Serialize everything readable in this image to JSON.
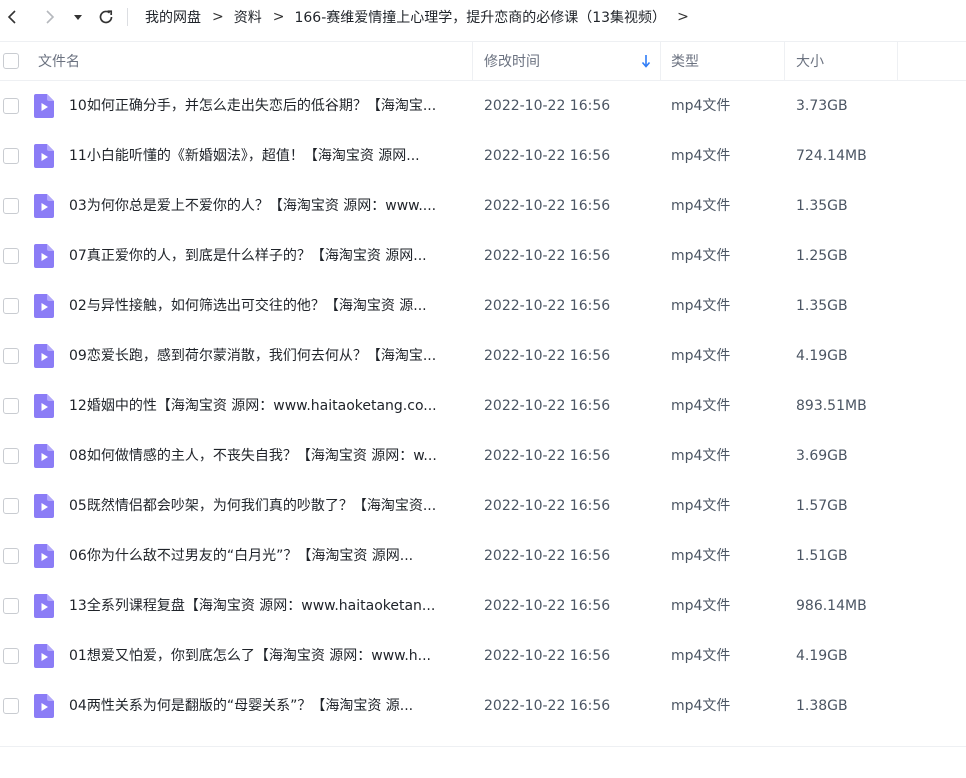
{
  "toolbar": {
    "back_icon": "chevron-left-icon",
    "forward_icon": "chevron-right-icon",
    "dropdown_icon": "caret-down-icon",
    "refresh_icon": "refresh-icon"
  },
  "breadcrumb": {
    "items": [
      "我的网盘",
      "资料",
      "166-赛维爱情撞上心理学，提升恋商的必修课（13集视频）"
    ],
    "separator": ">"
  },
  "table": {
    "headers": {
      "name": "文件名",
      "time": "修改时间",
      "type": "类型",
      "size": "大小"
    },
    "sort_icon": "arrow-down-icon",
    "rows": [
      {
        "name": "10如何正确分手，并怎么走出失恋后的低谷期？【海淘宝...",
        "time": "2022-10-22 16:56",
        "type": "mp4文件",
        "size": "3.73GB"
      },
      {
        "name": "11小白能听懂的《新婚姻法》，超值！【海淘宝资 源网...",
        "time": "2022-10-22 16:56",
        "type": "mp4文件",
        "size": "724.14MB"
      },
      {
        "name": "03为何你总是爱上不爱你的人？【海淘宝资 源网：www....",
        "time": "2022-10-22 16:56",
        "type": "mp4文件",
        "size": "1.35GB"
      },
      {
        "name": "07真正爱你的人，到底是什么样子的？【海淘宝资 源网...",
        "time": "2022-10-22 16:56",
        "type": "mp4文件",
        "size": "1.25GB"
      },
      {
        "name": "02与异性接触，如何筛选出可交往的他？【海淘宝资 源...",
        "time": "2022-10-22 16:56",
        "type": "mp4文件",
        "size": "1.35GB"
      },
      {
        "name": "09恋爱长跑，感到荷尔蒙消散，我们何去何从？【海淘宝...",
        "time": "2022-10-22 16:56",
        "type": "mp4文件",
        "size": "4.19GB"
      },
      {
        "name": "12婚姻中的性【海淘宝资 源网：www.haitaoketang.co...",
        "time": "2022-10-22 16:56",
        "type": "mp4文件",
        "size": "893.51MB"
      },
      {
        "name": "08如何做情感的主人，不丧失自我？【海淘宝资 源网：w...",
        "time": "2022-10-22 16:56",
        "type": "mp4文件",
        "size": "3.69GB"
      },
      {
        "name": "05既然情侣都会吵架，为何我们真的吵散了？【海淘宝资...",
        "time": "2022-10-22 16:56",
        "type": "mp4文件",
        "size": "1.57GB"
      },
      {
        "name": "06你为什么敌不过男友的“白月光”？【海淘宝资 源网...",
        "time": "2022-10-22 16:56",
        "type": "mp4文件",
        "size": "1.51GB"
      },
      {
        "name": "13全系列课程复盘【海淘宝资 源网：www.haitaoketan...",
        "time": "2022-10-22 16:56",
        "type": "mp4文件",
        "size": "986.14MB"
      },
      {
        "name": "01想爱又怕爱，你到底怎么了【海淘宝资 源网：www.h...",
        "time": "2022-10-22 16:56",
        "type": "mp4文件",
        "size": "4.19GB"
      },
      {
        "name": "04两性关系为何是翻版的“母婴关系”？【海淘宝资 源...",
        "time": "2022-10-22 16:56",
        "type": "mp4文件",
        "size": "1.38GB"
      }
    ],
    "file_icon": "video-file-icon",
    "colors": {
      "file_icon": "#8b7cf6",
      "sort_arrow": "#2f7cf6",
      "border": "#eef0f3"
    }
  }
}
